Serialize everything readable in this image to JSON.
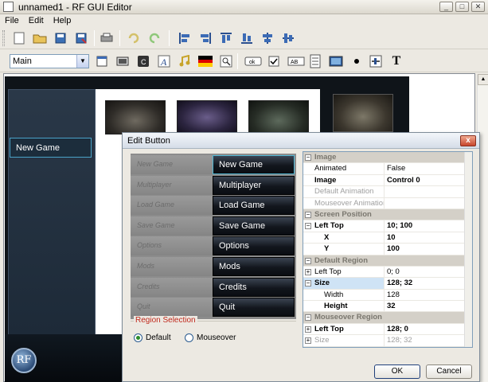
{
  "window": {
    "title": "unnamed1 - RF GUI Editor",
    "minimize": "_",
    "maximize": "□",
    "close": "✕"
  },
  "menu": [
    "File",
    "Edit",
    "Help"
  ],
  "toolbar2": {
    "screen_select": "Main",
    "text_tool": "T",
    "label_tool": "AB",
    "button_tool": "ok"
  },
  "game": {
    "menu_item": "New Game",
    "logo": "RF"
  },
  "dialog": {
    "title": "Edit Button",
    "close": "x",
    "preview_buttons": [
      "New Game",
      "Multiplayer",
      "Load Game",
      "Save Game",
      "Options",
      "Mods",
      "Credits",
      "Quit"
    ],
    "region_selection": {
      "legend": "Region Selection",
      "options": [
        "Default",
        "Mouseover"
      ],
      "selected": "Default"
    },
    "properties": [
      {
        "kind": "cat",
        "name": "Image",
        "toggle": "−"
      },
      {
        "kind": "row",
        "name": "Animated",
        "value": "False"
      },
      {
        "kind": "bold",
        "name": "Image",
        "value": "Control  0"
      },
      {
        "kind": "dim",
        "name": "Default Animation",
        "value": ""
      },
      {
        "kind": "dim",
        "name": "Mouseover Animation",
        "value": ""
      },
      {
        "kind": "cat",
        "name": "Screen Position",
        "toggle": "−"
      },
      {
        "kind": "bold",
        "name": "Left Top",
        "value": "10; 100",
        "toggle": "−"
      },
      {
        "kind": "bold-indent",
        "name": "X",
        "value": "10"
      },
      {
        "kind": "bold-indent",
        "name": "Y",
        "value": "100"
      },
      {
        "kind": "cat",
        "name": "Default Region",
        "toggle": "−"
      },
      {
        "kind": "row",
        "name": "Left Top",
        "value": "0; 0",
        "toggle": "+"
      },
      {
        "kind": "bold-hl",
        "name": "Size",
        "value": "128; 32",
        "toggle": "−"
      },
      {
        "kind": "indent",
        "name": "Width",
        "value": "128"
      },
      {
        "kind": "bold-indent",
        "name": "Height",
        "value": "32"
      },
      {
        "kind": "cat",
        "name": "Mouseover Region",
        "toggle": "−"
      },
      {
        "kind": "bold",
        "name": "Left Top",
        "value": "128; 0",
        "toggle": "+"
      },
      {
        "kind": "dim",
        "name": "Size",
        "value": "128; 32",
        "toggle": "+"
      }
    ],
    "ok": "OK",
    "cancel": "Cancel"
  }
}
